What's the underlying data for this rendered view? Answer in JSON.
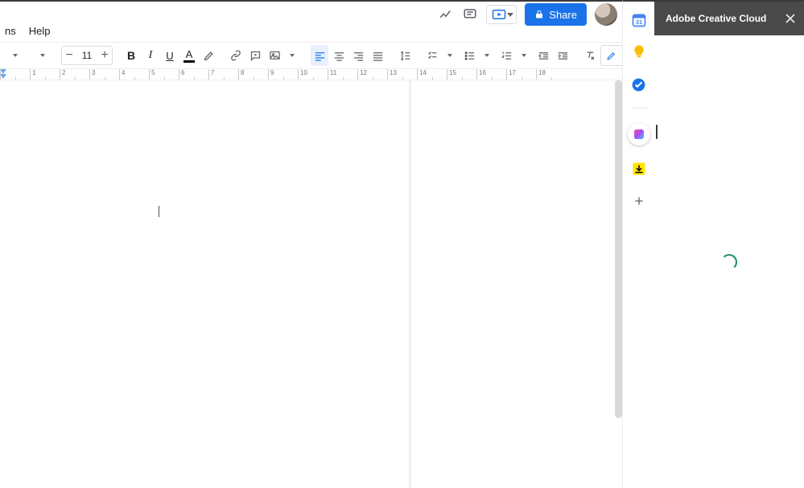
{
  "menubar": {
    "items_partial": [
      "ns",
      "Help"
    ]
  },
  "toolbar": {
    "font_size": "11",
    "editing_label": "Editing"
  },
  "share": {
    "label": "Share"
  },
  "ruler": {
    "marks": [
      "",
      "1",
      "2",
      "3",
      "4",
      "5",
      "6",
      "7",
      "8",
      "9",
      "10",
      "11",
      "12",
      "13",
      "14",
      "15",
      "16",
      "17",
      "18"
    ]
  },
  "side_panel": {
    "title": "Adobe Creative Cloud"
  },
  "colors": {
    "accent": "#1a73e8"
  }
}
